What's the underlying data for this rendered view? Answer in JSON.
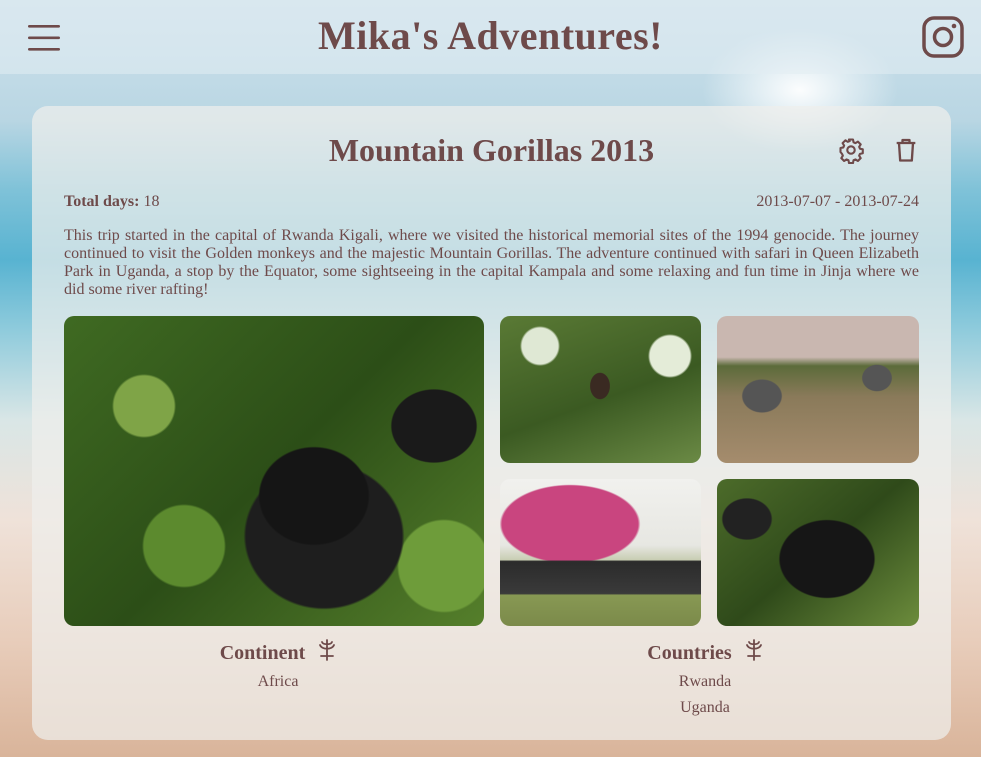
{
  "header": {
    "site_title": "Mika's Adventures!",
    "menu_icon": "hamburger-menu-icon",
    "social_icon": "instagram-icon"
  },
  "trip": {
    "title": "Mountain Gorillas 2013",
    "total_days_label": "Total days:",
    "total_days": "18",
    "date_range": "2013-07-07 - 2013-07-24",
    "description": "This trip started in the capital of Rwanda Kigali, where we visited the historical memorial sites of the 1994 genocide. The journey continued to visit the Golden monkeys and the majestic Mountain Gorillas. The adventure continued with safari in Queen Elizabeth Park in Uganda, a stop by the Equator, some sightseeing in the capital Kampala and some relaxing and fun time in Jinja where we did some river rafting!",
    "actions": {
      "settings_icon": "gear-icon",
      "delete_icon": "trash-icon"
    },
    "photos": [
      "gorilla",
      "bat-in-tree",
      "elephants-on-road",
      "group-at-equator",
      "gorilla-in-foliage"
    ]
  },
  "info": {
    "continent_label": "Continent",
    "continents": [
      "Africa"
    ],
    "countries_label": "Countries",
    "countries": [
      "Rwanda",
      "Uganda"
    ],
    "icon": "globe-stand-icon"
  },
  "colors": {
    "text": "#6e4a4a"
  }
}
